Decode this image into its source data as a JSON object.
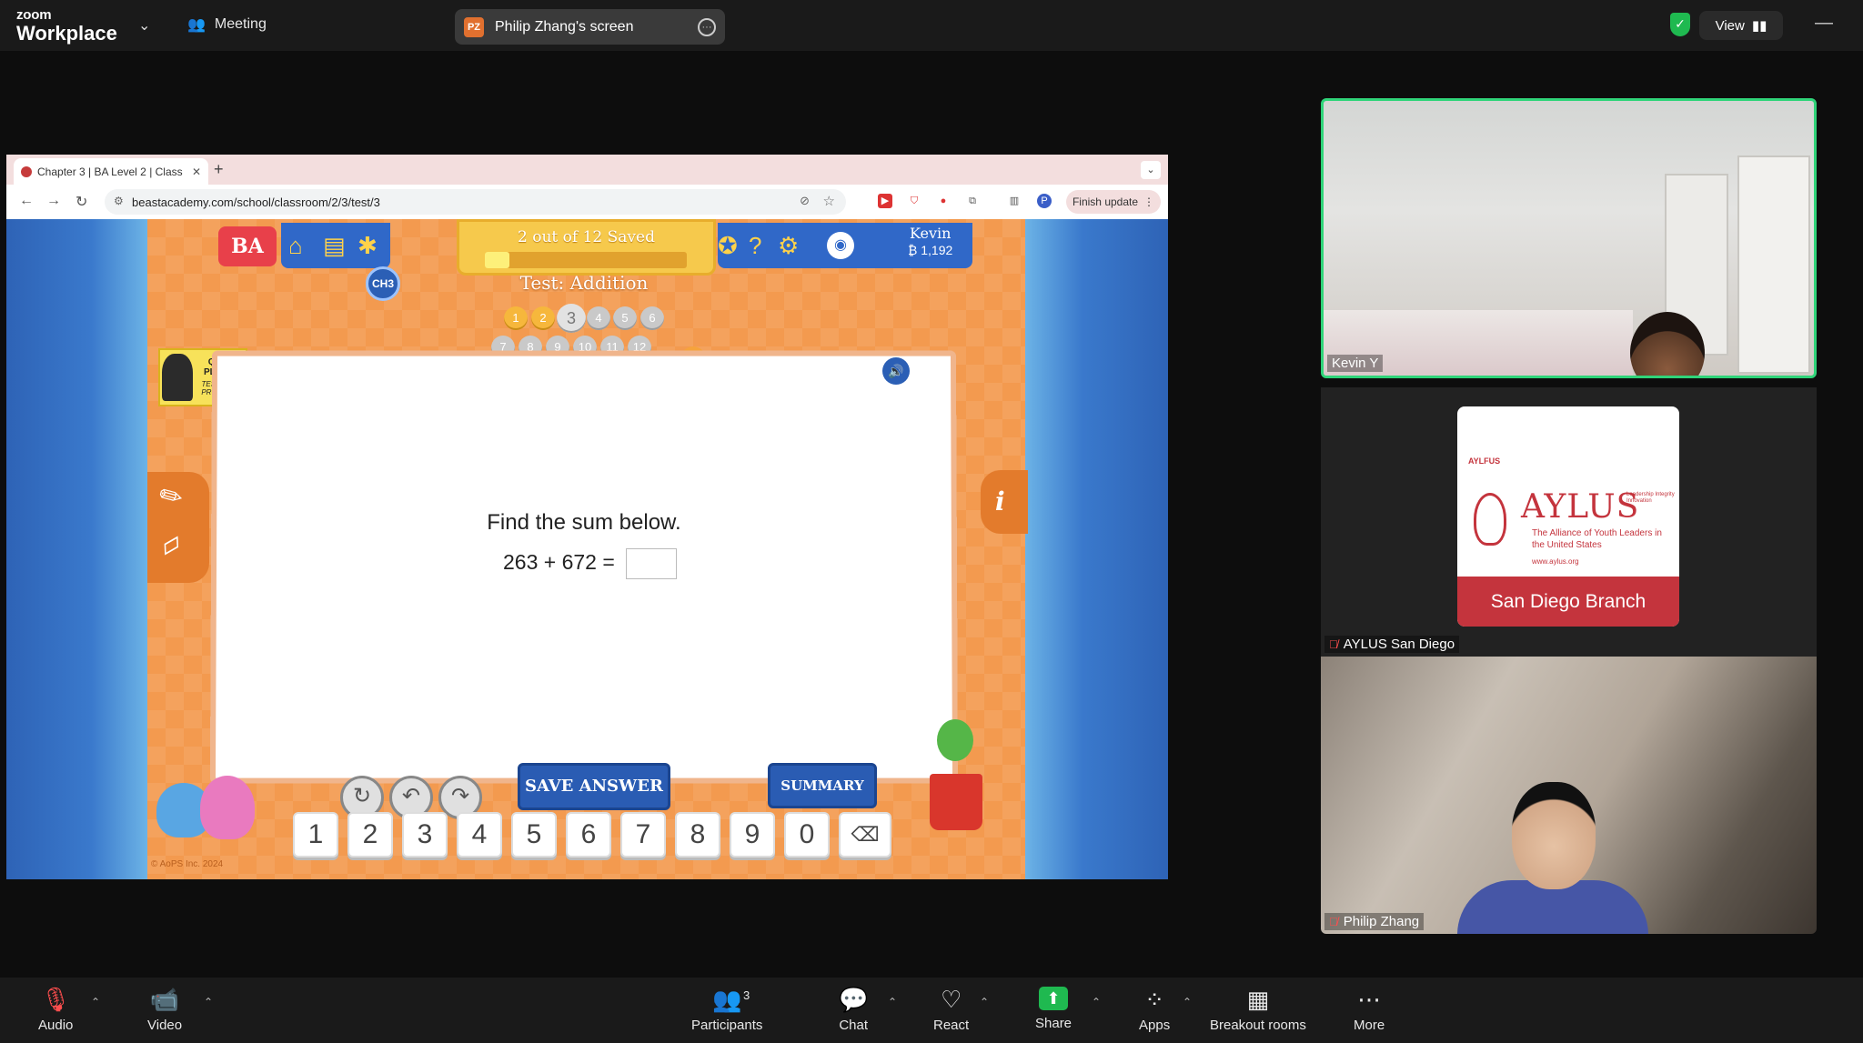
{
  "zoom": {
    "brand_small": "zoom",
    "brand_large": "Workplace",
    "meeting_label": "Meeting",
    "share_badge": "PZ",
    "share_label": "Philip Zhang's screen",
    "view_label": "View"
  },
  "browser": {
    "tab_title": "Chapter 3 | BA Level 2 | Class",
    "url": "beastacademy.com/school/classroom/2/3/test/3",
    "finish_update": "Finish update"
  },
  "game": {
    "logo": "BA",
    "saved_text": "2 out of 12 Saved",
    "progress_fraction": 0.12,
    "user_name": "Kevin",
    "user_coins": "₿ 1,192",
    "chapter_badge": "CH3",
    "test_title": "Test: Addition",
    "question_numbers": [
      "1",
      "2",
      "3",
      "4",
      "5",
      "6",
      "7",
      "8",
      "9",
      "10",
      "11",
      "12"
    ],
    "quiet_sign_line1": "QUIET PLEASE",
    "quiet_sign_line2": "TESTING IN PROGRESS",
    "prompt": "Find the sum below.",
    "equation": "263 + 672 =",
    "save_answer": "SAVE ANSWER",
    "summary": "SUMMARY",
    "keypad": [
      "1",
      "2",
      "3",
      "4",
      "5",
      "6",
      "7",
      "8",
      "9",
      "0"
    ],
    "copyright": "© AoPS Inc. 2024"
  },
  "participants": {
    "kevin": "Kevin Y",
    "aylus_tile_name": "AYLUS San Diego",
    "aylus_small": "AYLFUS",
    "aylus_big": "AYLUS",
    "aylus_motto": "Leadership Integrity Innovation",
    "aylus_sub": "The Alliance of Youth Leaders in the United States",
    "aylus_web": "www.aylus.org",
    "aylus_banner": "San Diego Branch",
    "philip": "Philip Zhang"
  },
  "toolbar": {
    "audio": "Audio",
    "video": "Video",
    "participants": "Participants",
    "participants_count": "3",
    "chat": "Chat",
    "react": "React",
    "share": "Share",
    "apps": "Apps",
    "breakout": "Breakout rooms",
    "more": "More"
  }
}
